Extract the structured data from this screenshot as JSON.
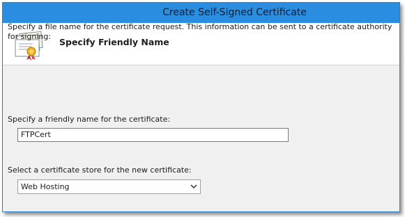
{
  "window": {
    "title": "Create Self-Signed Certificate"
  },
  "header": {
    "title": "Specify Friendly Name",
    "icon": "certificate-icon"
  },
  "body": {
    "description": "Specify a file name for the certificate request.  This information can be sent to a certificate authority for signing:",
    "friendly_name_label": "Specify a friendly name for the certificate:",
    "friendly_name_value": "FTPCert",
    "store_label": "Select a certificate store for the new certificate:",
    "store_value": "Web Hosting",
    "store_icon": "chevron-down-icon"
  },
  "colors": {
    "titlebar": "#2b8de0",
    "body_background": "#f0f0f0"
  }
}
